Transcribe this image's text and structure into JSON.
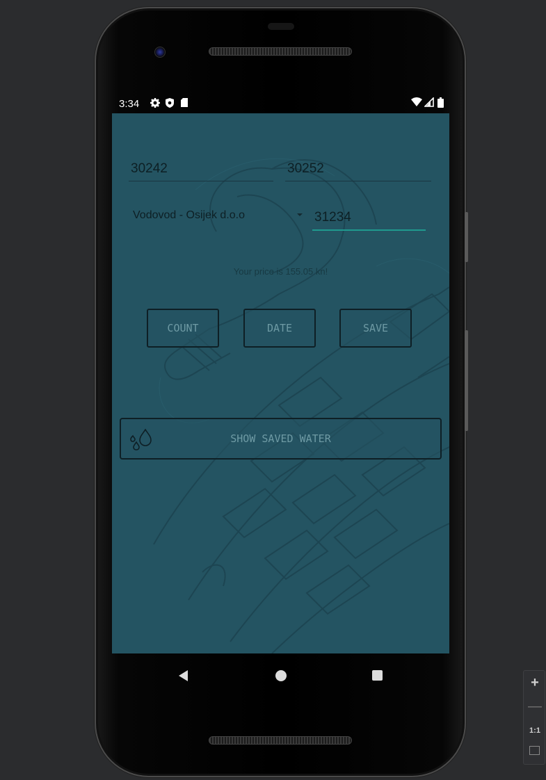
{
  "status_bar": {
    "time": "3:34",
    "left_icons": [
      "settings-icon",
      "shield-icon",
      "sd-card-icon"
    ],
    "right_icons": [
      "wifi-icon",
      "signal-icon",
      "battery-icon"
    ]
  },
  "form": {
    "start_reading": "30242",
    "end_reading": "30252",
    "provider_selected": "Vodovod - Osijek d.o.o",
    "code_value": "31234"
  },
  "result": {
    "price_text": "Your price is 155.05 kn!"
  },
  "buttons": {
    "count_label": "COUNT",
    "date_label": "DATE",
    "save_label": "SAVE",
    "show_saved_label": "SHOW SAVED WATER"
  },
  "emulator_zoom": {
    "plus": "+",
    "minus": "—",
    "one_to_one": "1:1"
  },
  "colors": {
    "screen_bg": "#245462",
    "accent": "#1f9a8e",
    "button_text": "#6e9aa4"
  }
}
